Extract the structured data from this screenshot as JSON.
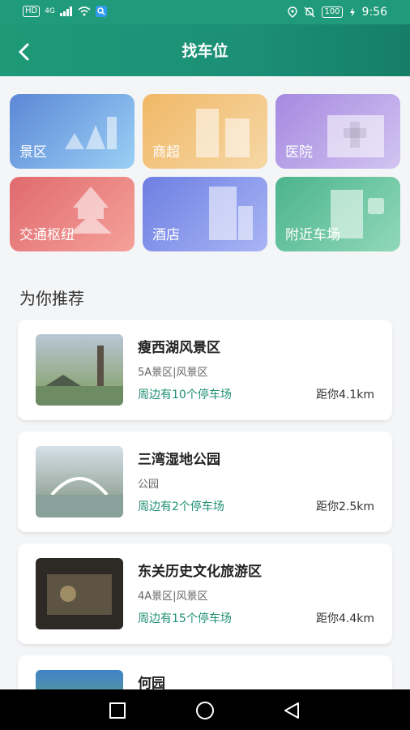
{
  "status_bar": {
    "network": "HD",
    "signal_label": "4G",
    "battery": "100",
    "time": "9:56",
    "icons": [
      "signal-icon",
      "wifi-icon",
      "app-icon",
      "location-icon",
      "mute-icon",
      "battery-icon",
      "charging-icon"
    ]
  },
  "header": {
    "title": "找车位",
    "back_icon": "chevron-left-icon"
  },
  "categories": [
    {
      "label": "景区",
      "color_a": "#5c87d6",
      "color_b": "#9ad0f5"
    },
    {
      "label": "商超",
      "color_a": "#f0b866",
      "color_b": "#f6d7a5"
    },
    {
      "label": "医院",
      "color_a": "#a589e0",
      "color_b": "#d2c4f1"
    },
    {
      "label": "交通枢纽",
      "color_a": "#e06a6e",
      "color_b": "#f5a19a"
    },
    {
      "label": "酒店",
      "color_a": "#6d7fe2",
      "color_b": "#a9b5f5"
    },
    {
      "label": "附近车场",
      "color_a": "#4bb48e",
      "color_b": "#91d8b8"
    }
  ],
  "section_title": "为你推荐",
  "places": [
    {
      "name": "瘦西湖风景区",
      "type": "5A景区|风景区",
      "parking": "周边有10个停车场",
      "distance": "距你4.1km",
      "thumb_a": "#7f9c5c",
      "thumb_b": "#b9c7d6"
    },
    {
      "name": "三湾湿地公园",
      "type": "公园",
      "parking": "周边有2个停车场",
      "distance": "距你2.5km",
      "thumb_a": "#7b8f7c",
      "thumb_b": "#c7d4de"
    },
    {
      "name": "东关历史文化旅游区",
      "type": "4A景区|风景区",
      "parking": "周边有15个停车场",
      "distance": "距你4.4km",
      "thumb_a": "#2d2a25",
      "thumb_b": "#6a5f4c"
    },
    {
      "name": "何园",
      "type": "",
      "parking": "",
      "distance": "",
      "thumb_a": "#3f83c7",
      "thumb_b": "#7fb55b"
    }
  ],
  "navbar": {
    "icons": [
      "square-icon",
      "circle-icon",
      "triangle-back-icon"
    ]
  }
}
